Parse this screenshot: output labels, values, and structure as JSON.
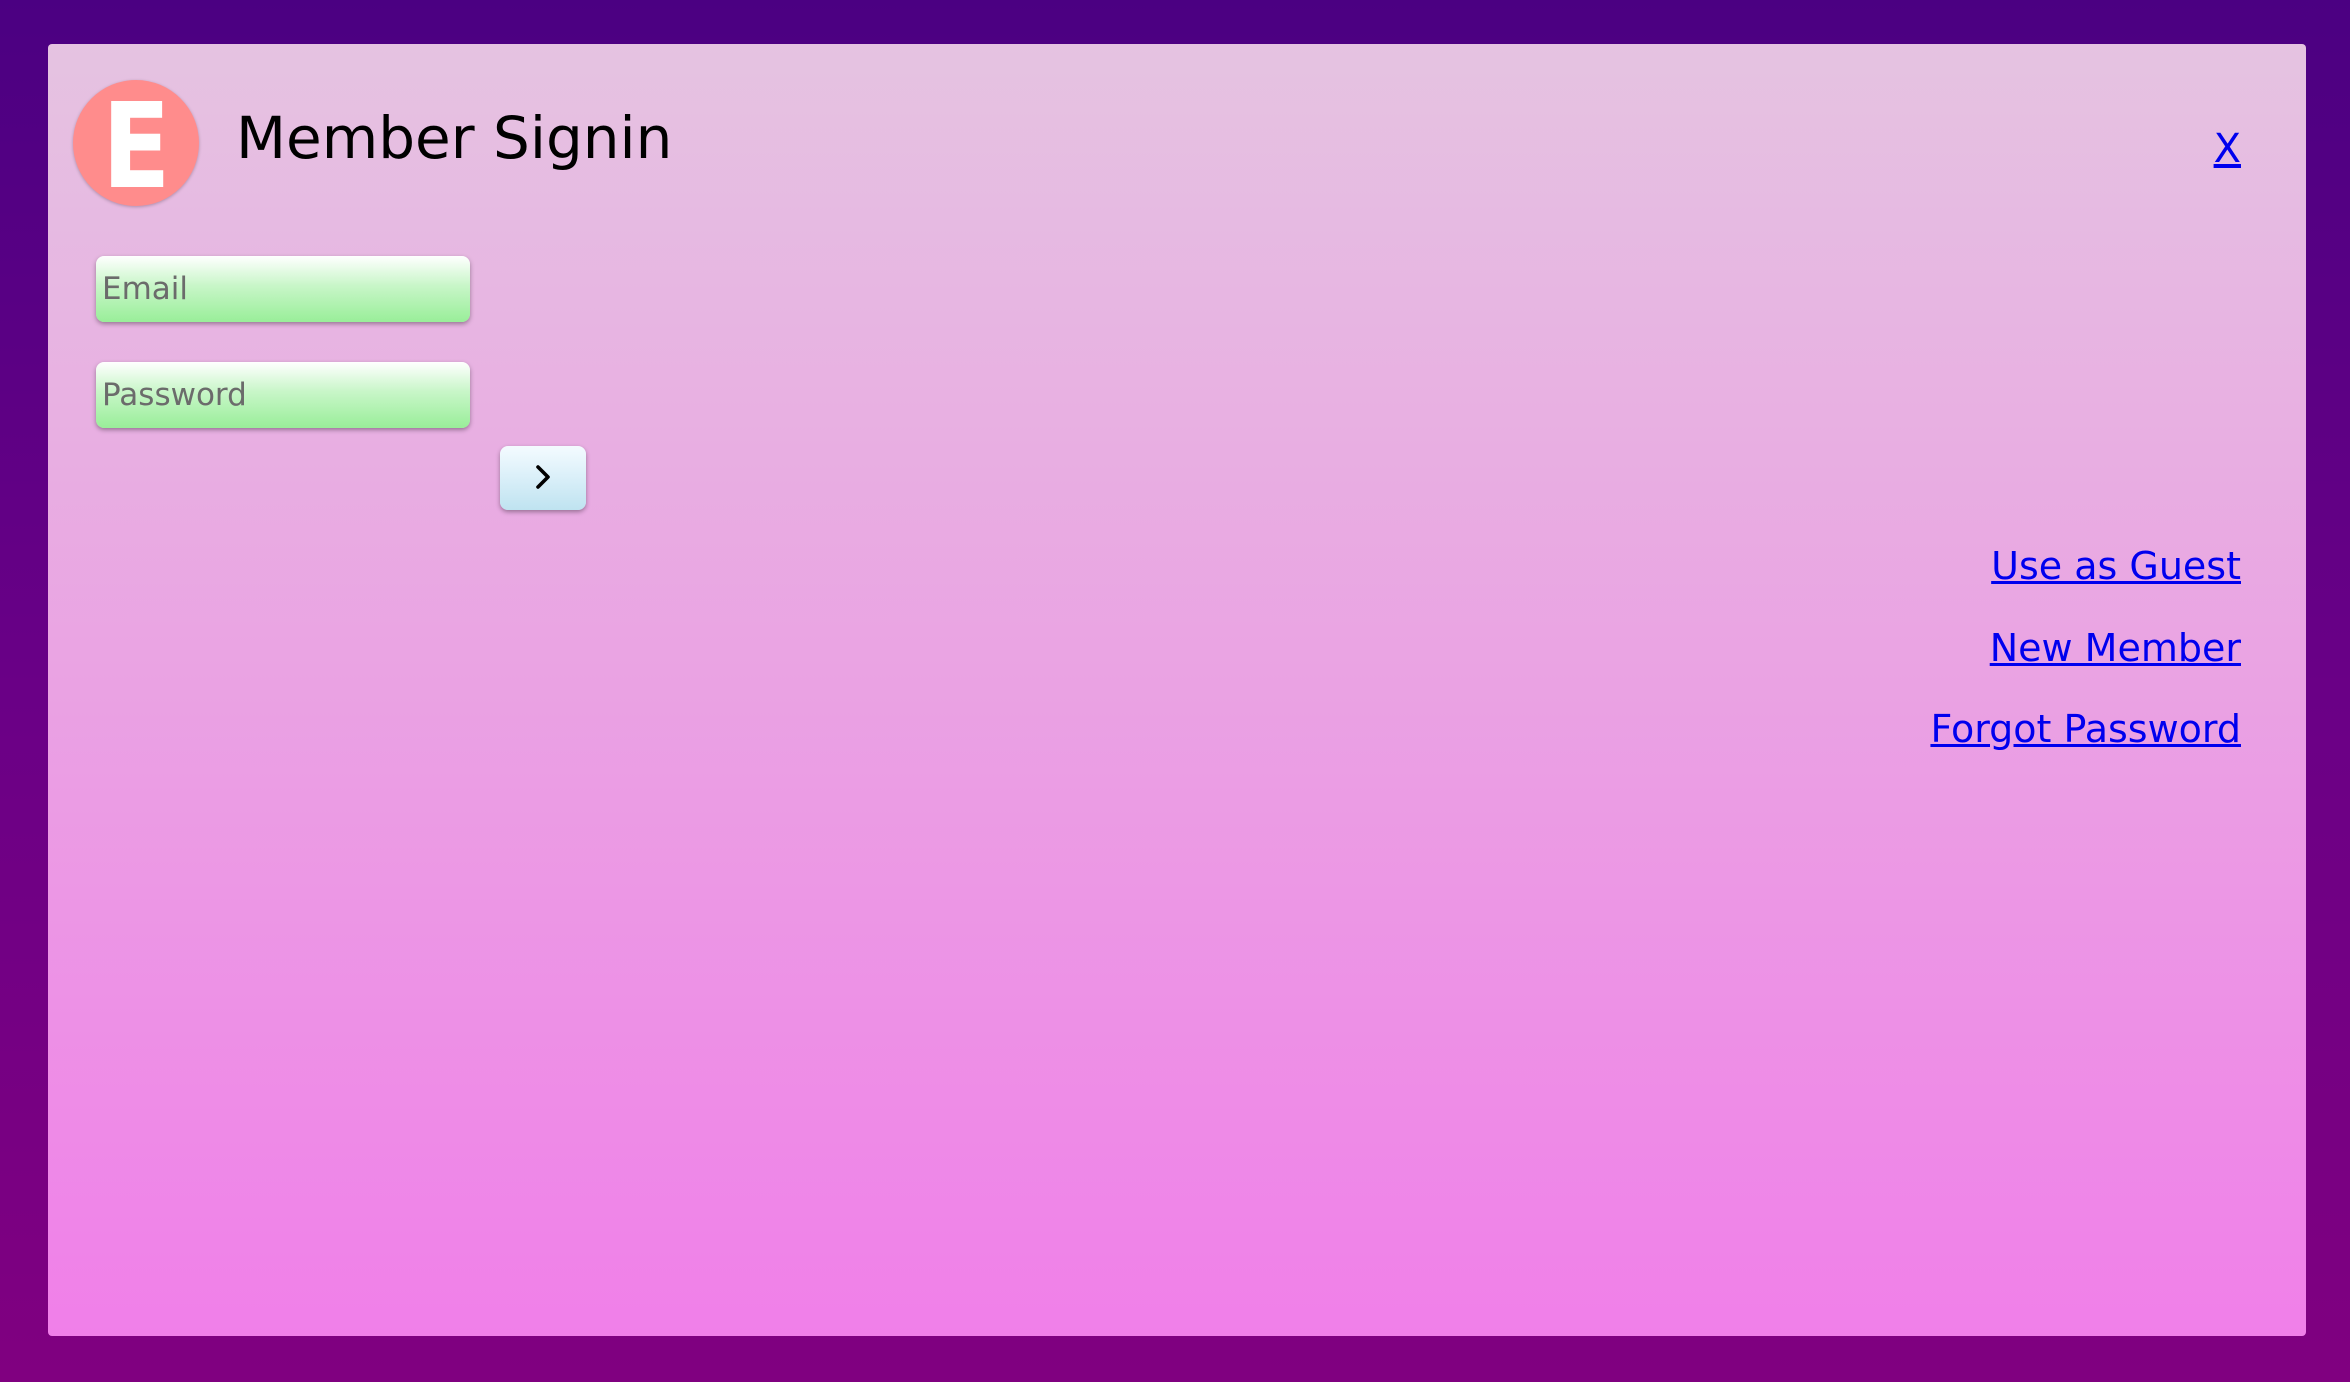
{
  "dialog": {
    "logo_letter": "E",
    "title": "Member Signin",
    "close_label": "X"
  },
  "form": {
    "email_placeholder": "Email",
    "password_placeholder": "Password",
    "submit_icon": "chevron-right-icon"
  },
  "links": [
    {
      "label": "Use as Guest"
    },
    {
      "label": "New Member"
    },
    {
      "label": "Forgot Password"
    }
  ],
  "colors": {
    "page_background": "#4b0082",
    "dialog_top": "#e5c3e1",
    "dialog_bottom": "#f07fe9",
    "logo_background": "#ff8c8c",
    "field_green": "#99ee99",
    "link_blue": "#0000ee"
  }
}
